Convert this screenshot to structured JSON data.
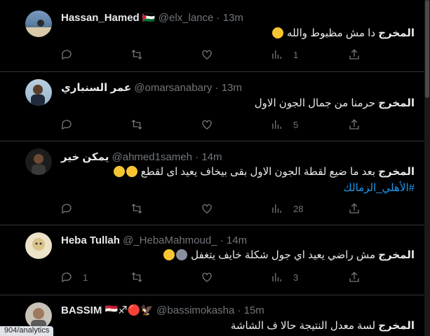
{
  "tweets": [
    {
      "name": "Hassan_Hamed",
      "flag": "🇵🇸",
      "handle": "@elx_lance",
      "time": "· 13m",
      "bold": "المخرج",
      "text": "دا مش مظبوط والله",
      "hashtag": "",
      "counts": {
        "reply": "",
        "retweet": "",
        "like": "",
        "views": "1"
      }
    },
    {
      "name": "عمر السنباري",
      "flag": "",
      "handle": "@omarsanabary",
      "time": "· 13m",
      "bold": "المخرج",
      "text": "حرمنا من جمال الجون الاول",
      "hashtag": "",
      "counts": {
        "reply": "",
        "retweet": "",
        "like": "",
        "views": "5"
      }
    },
    {
      "name": "يمكن خير",
      "flag": "",
      "handle": "@ahmed1sameh",
      "time": "· 14m",
      "bold": "المخرج",
      "text": "بعد ما ضيع لقطة الجون الاول بقى بيخاف يعيد اى لقطع",
      "hashtag": "#الأهلي_الزمالك",
      "counts": {
        "reply": "",
        "retweet": "",
        "like": "",
        "views": "28"
      }
    },
    {
      "name": "Heba Tullah",
      "flag": "",
      "handle": "@_HebaMahmoud_",
      "time": "· 14m",
      "bold": "المخرج",
      "text": "مش راضي يعيد اي جول شكلة خايف يتغفل",
      "hashtag": "",
      "counts": {
        "reply": "1",
        "retweet": "",
        "like": "",
        "views": "3"
      }
    },
    {
      "name": "BASSIM",
      "flag": "🇪🇬♐🔴🦅",
      "handle": "@bassimokasha",
      "time": "· 15m",
      "bold": "المخرج",
      "text": "لسة معدل النتيجة حالا ف الشاشة",
      "hashtag": "",
      "counts": {
        "reply": "",
        "retweet": "",
        "like": "",
        "views": ""
      }
    }
  ],
  "status_url": "904/analytics",
  "colors": {
    "accent": "#1d9bf0",
    "muted": "#71767b",
    "emoji": "#f7c531"
  },
  "icons": [
    "reply-icon",
    "retweet-icon",
    "like-icon",
    "views-icon",
    "share-icon"
  ]
}
